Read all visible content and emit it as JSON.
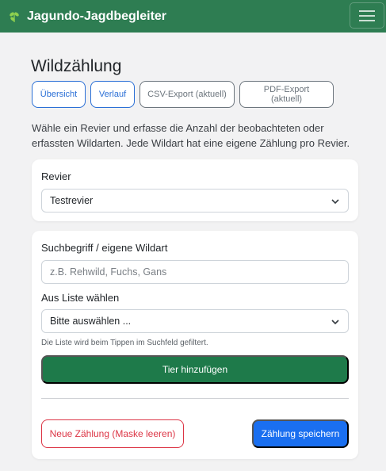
{
  "navbar": {
    "brand": "Jagundo-Jagdbegleiter",
    "brand_icon": "leaf-icon",
    "menu_icon": "hamburger-menu-icon",
    "color": "#2e7d52"
  },
  "page": {
    "title": "Wildzählung",
    "intro": "Wähle ein Revier und erfasse die Anzahl der beobachteten oder erfassten Wildarten. Jede Wildart hat eine eigene Zählung pro Revier."
  },
  "actions": {
    "overview": "Übersicht",
    "history": "Verlauf",
    "csv_export": "CSV-Export (aktuell)",
    "pdf_export": "PDF-Export (aktuell)"
  },
  "revier": {
    "label": "Revier",
    "value": "Testrevier"
  },
  "search": {
    "label": "Suchbegriff / eigene Wildart",
    "placeholder": "z.B. Rehwild, Fuchs, Gans"
  },
  "list": {
    "label": "Aus Liste wählen",
    "value": "Bitte auswählen ...",
    "help": "Die Liste wird beim Tippen im Suchfeld gefiltert."
  },
  "buttons": {
    "add": "Tier hinzufügen",
    "reset": "Neue Zählung (Maske leeren)",
    "save": "Zählung speichern"
  },
  "colors": {
    "primary_green": "#1e7a4a",
    "primary_blue": "#1a6ff0",
    "danger": "#dc3545",
    "outline_blue": "#2a6fd6"
  }
}
